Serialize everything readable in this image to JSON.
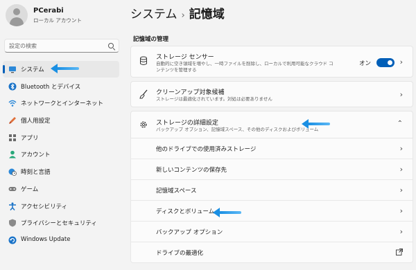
{
  "user": {
    "name": "PCerabi",
    "account": "ローカル アカウント"
  },
  "search": {
    "placeholder": "設定の検索"
  },
  "nav": [
    {
      "label": "システム",
      "icon": "monitor-icon"
    },
    {
      "label": "Bluetooth とデバイス",
      "icon": "bluetooth-icon"
    },
    {
      "label": "ネットワークとインターネット",
      "icon": "wifi-icon"
    },
    {
      "label": "個人用設定",
      "icon": "brush-icon"
    },
    {
      "label": "アプリ",
      "icon": "apps-icon"
    },
    {
      "label": "アカウント",
      "icon": "person-icon"
    },
    {
      "label": "時刻と言語",
      "icon": "globe-clock-icon"
    },
    {
      "label": "ゲーム",
      "icon": "gamepad-icon"
    },
    {
      "label": "アクセシビリティ",
      "icon": "accessibility-icon"
    },
    {
      "label": "プライバシーとセキュリティ",
      "icon": "shield-icon"
    },
    {
      "label": "Windows Update",
      "icon": "update-icon"
    }
  ],
  "breadcrumb": {
    "parent": "システム",
    "sep": "›",
    "current": "記憶域"
  },
  "section_title": "記憶域の管理",
  "storage_sense": {
    "title": "ストレージ センサー",
    "desc": "自動的に空き領域を増やし、一時ファイルを削除し、ローカルで利用可能なクラウド コンテンツを管理する",
    "toggle_label": "オン",
    "toggle_on": true
  },
  "cleanup": {
    "title": "クリーンアップ対象候補",
    "desc": "ストレージは最適化されています。対処は必要ありません"
  },
  "advanced": {
    "title": "ストレージの詳細設定",
    "desc": "バックアップ オプション、記憶域スペース、その他のディスクおよびボリューム",
    "items": [
      {
        "label": "他のドライブでの使用済みストレージ"
      },
      {
        "label": "新しいコンテンツの保存先"
      },
      {
        "label": "記憶域スペース"
      },
      {
        "label": "ディスクとボリューム"
      },
      {
        "label": "バックアップ オプション"
      },
      {
        "label": "ドライブの最適化"
      }
    ]
  },
  "colors": {
    "accent": "#005fb8",
    "arrow": "#1a8fe3"
  }
}
